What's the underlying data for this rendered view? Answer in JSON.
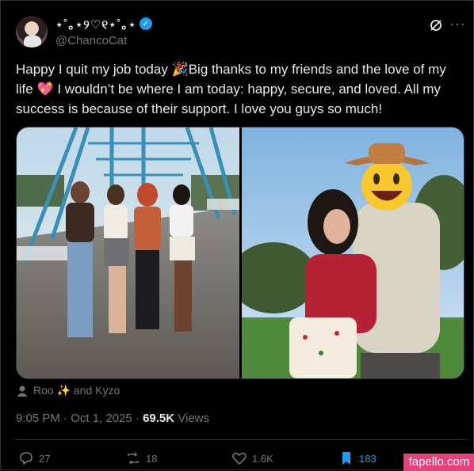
{
  "tweet": {
    "display_name": "⋆˚｡⋆୨♡୧⋆˚｡⋆",
    "verified_mark": "✓",
    "handle": "@ChancoCat",
    "text": "Happy I quit my job today 🎉Big thanks to my friends and the love of my life 💖 I wouldn’t be where I am today: happy, secure, and loved. All my success is because of their support. I love you guys so much!",
    "tagged_people": "Roo ✨ and Kyzo",
    "time": "9:05 PM · Oct 1, 2025 · ",
    "views_count": "69.5K",
    "views_label": " Views"
  },
  "actions": {
    "replies": "27",
    "reposts": "18",
    "likes": "1.6K",
    "bookmarks": "183"
  },
  "watermark": "fapello.com",
  "icons": [
    "grok-icon",
    "more-icon",
    "person-icon",
    "reply-icon",
    "repost-icon",
    "like-icon",
    "bookmark-icon"
  ]
}
